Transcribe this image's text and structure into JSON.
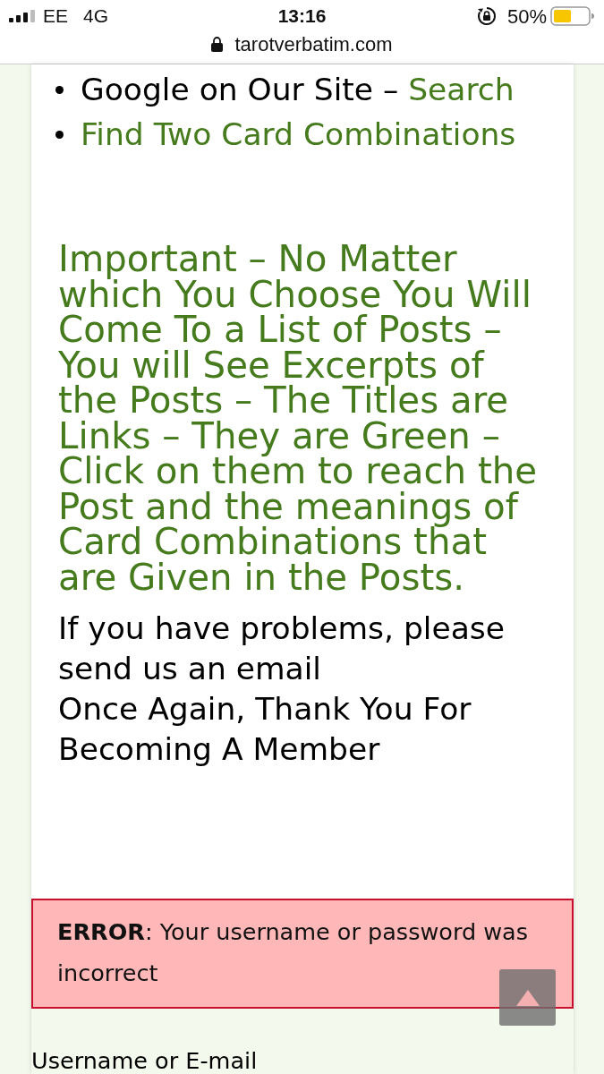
{
  "status_bar": {
    "carrier": "EE",
    "network": "4G",
    "time": "13:16",
    "battery": "50%"
  },
  "address_bar": {
    "url": "tarotverbatim.com"
  },
  "list": [
    {
      "parts": [
        {
          "kind": "text",
          "text": "Google on Our Site – "
        },
        {
          "kind": "link",
          "text": "Search"
        }
      ]
    },
    {
      "parts": [
        {
          "kind": "link",
          "text": "Find Two Card Combinations"
        }
      ]
    }
  ],
  "notice": "Important – No Matter which You Choose You Will Come To a List of Posts – You will See Excerpts of the Posts – The Titles are Links – They are Green – Click on them to reach the Post and the meanings of Card Combinations that are Given in the Posts.",
  "paragraphs": [
    "If you have problems, please send us an email",
    "Once Again, Thank You For Becoming A Member"
  ],
  "error": {
    "message": "**ERROR**: Your username or password was incorrect"
  },
  "login": {
    "username_label": "Username or E-mail"
  }
}
